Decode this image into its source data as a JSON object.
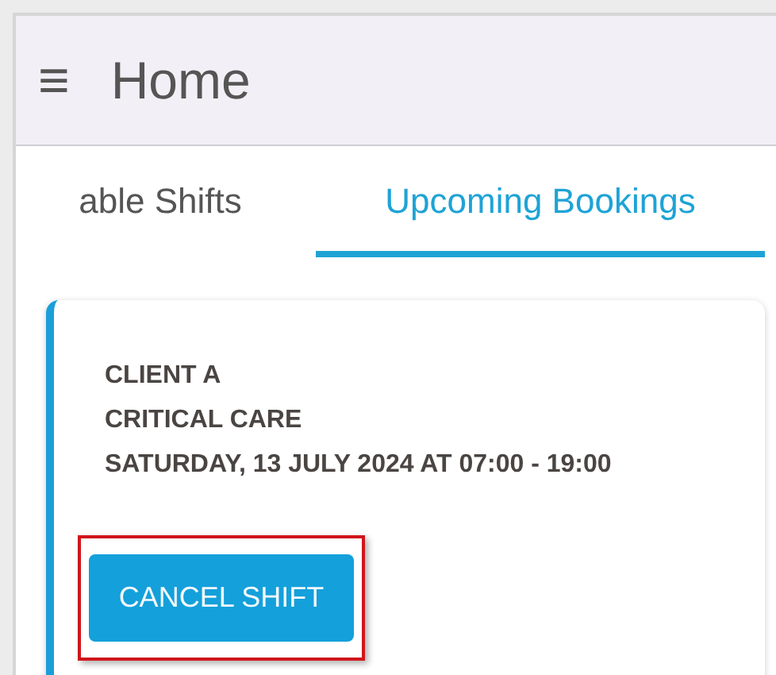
{
  "app_bar": {
    "menu_icon": "≡",
    "title": "Home"
  },
  "tabs": [
    {
      "label": "able Shifts",
      "selected": false
    },
    {
      "label": "Upcoming Bookings",
      "selected": true
    }
  ],
  "booking": {
    "lines": [
      "CLIENT A",
      "CRITICAL CARE",
      "SATURDAY, 13 JULY 2024 AT 07:00 - 19:00"
    ],
    "button": "CANCEL SHIFT",
    "highlighted": true
  }
}
